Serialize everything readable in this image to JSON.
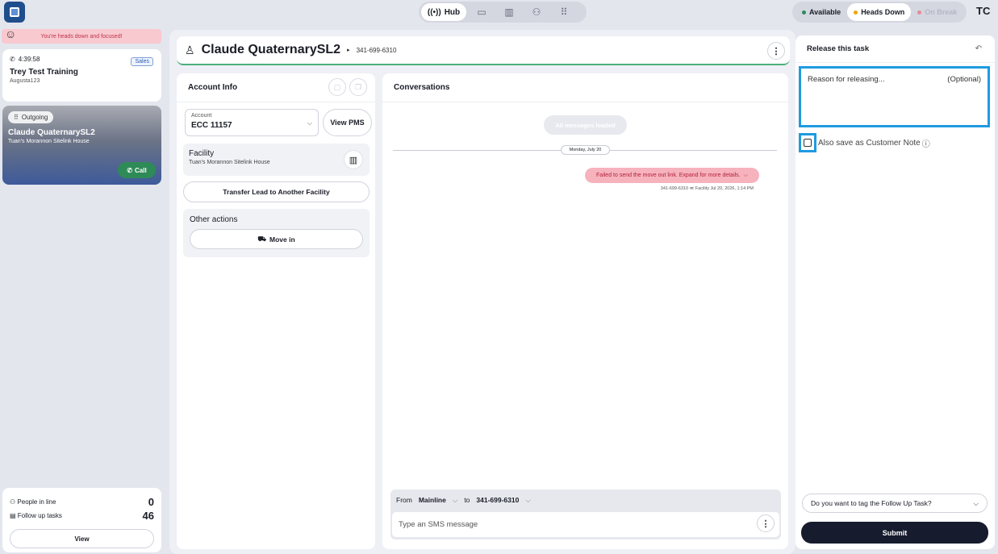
{
  "topbar": {
    "nav": {
      "hub_label": "Hub"
    },
    "status": {
      "available": "Available",
      "heads_down": "Heads Down",
      "on_break": "On Break",
      "colors": {
        "available": "#2e8b57",
        "heads_down": "#f0a500",
        "on_break": "#e88a9a"
      }
    },
    "avatar_initials": "TC"
  },
  "left": {
    "banner": "You're heads down and focused!",
    "active_task": {
      "timer": "4:39:58",
      "tag": "Sales",
      "title": "Trey Test Training",
      "subtitle": "Augusta123"
    },
    "outgoing": {
      "chip": "Outgoing",
      "name": "Claude QuaternarySL2",
      "facility": "Tuan's Morannon Sitelink House",
      "call_label": "Call"
    },
    "stats": {
      "people_label": "People in line",
      "people_count": "0",
      "followup_label": "Follow up tasks",
      "followup_count": "46",
      "view_label": "View"
    }
  },
  "contact": {
    "name": "Claude QuaternarySL2",
    "phone": "341-699-6310"
  },
  "account_info": {
    "title": "Account Info",
    "account_label": "Account",
    "account_value": "ECC 11157",
    "view_pms": "View PMS",
    "facility_title": "Facility",
    "facility_name": "Tuan's Morannon Sitelink House",
    "transfer": "Transfer Lead to Another Facility",
    "other_actions": "Other actions",
    "move_in": "Move in"
  },
  "conversations": {
    "title": "Conversations",
    "all_loaded": "All messages loaded",
    "date": "Monday, July 20",
    "error_message": "Failed to send the move out link. Expand for more details.",
    "meta": "341-699-6310 ≪ Facility  Jul 20, 2026, 1:14 PM",
    "composer": {
      "from_label": "From",
      "from_value": "Mainline",
      "to_label": "to",
      "to_value": "341-699-6310",
      "placeholder": "Type an SMS message"
    }
  },
  "release": {
    "title": "Release this task",
    "reason_placeholder": "Reason for releasing...",
    "optional": "(Optional)",
    "save_note": "Also save as Customer Note",
    "tag_question": "Do you want to tag the Follow Up Task?",
    "submit": "Submit"
  }
}
